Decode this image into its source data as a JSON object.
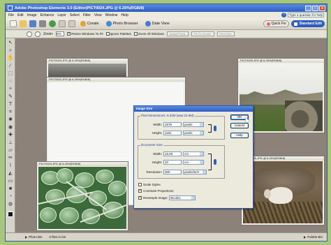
{
  "window": {
    "title": "Adobe Photoshop Elements 3.0 (Editor)PICT0024.JPG @ 6.25%(RGB/8)",
    "minimize": "_",
    "maximize": "□",
    "close": "x"
  },
  "menu": {
    "items": [
      "File",
      "Edit",
      "Image",
      "Enhance",
      "Layer",
      "Select",
      "Filter",
      "View",
      "Window",
      "Help"
    ],
    "help_placeholder": "Type a question for help"
  },
  "shortcuts": {
    "create": "Create",
    "photo_browser": "Photo Browser",
    "date_view": "Date View",
    "quick_fix": "Quick Fix",
    "standard_edit": "Standard Edit"
  },
  "options": {
    "zoom_label": "Zoom:",
    "zoom_value": "6%",
    "resize_windows": "Resize Windows To Fit",
    "ignore_palettes": "Ignore Palettes",
    "zoom_all_windows": "Zoom All Windows",
    "actual_pixels": "Actual Pixels",
    "fit_on_screen": "Fit On Screen",
    "print_size": "Print Size"
  },
  "documents": {
    "doc1_title": "PICT0023.JPG @ 6.25%(RGB/8)",
    "doc2_title": "PICT0022.JPG @ 6.25%(RGB/8)",
    "doc3_title": "PICT0024.JPG @ 6.25%(RGB/8)",
    "doc4_title": "PICT0025.JPG @ 6.25%(RGB/8)",
    "doc5_title": "PICT0026.JPG @ 6.25%(RGB/8)"
  },
  "dialog": {
    "title": "Image Size",
    "pixel_dimensions": "Pixel Dimensions: 9.32M (was:22.9M)",
    "width_label": "Width:",
    "width_value": "1675",
    "width_unit": "pixels",
    "height_label": "Height:",
    "height_value": "1181",
    "height_unit": "pixels",
    "document_size": "Document Size:",
    "doc_width_label": "Width:",
    "doc_width_value": "15.00",
    "doc_width_unit": "cm",
    "doc_height_label": "Height:",
    "doc_height_value": "10",
    "doc_height_unit": "cm",
    "resolution_label": "Resolution:",
    "resolution_value": "300",
    "resolution_unit": "pixels/inch",
    "scale_styles": "Scale Styles",
    "constrain_proportions": "Constrain Proportions",
    "resample_label": "Resample Image:",
    "resample_value": "Bicubic",
    "ok": "OK",
    "cancel": "Cancel",
    "help": "Help"
  },
  "status": {
    "photo_bin": "Photo Bin",
    "files_in_bin": "5 files in bin",
    "palette_bin": "Palette Bin"
  },
  "colors": {
    "accent": "#2d5cc2",
    "workspace": "#8c8279",
    "page_bg": "#a9c77b"
  }
}
